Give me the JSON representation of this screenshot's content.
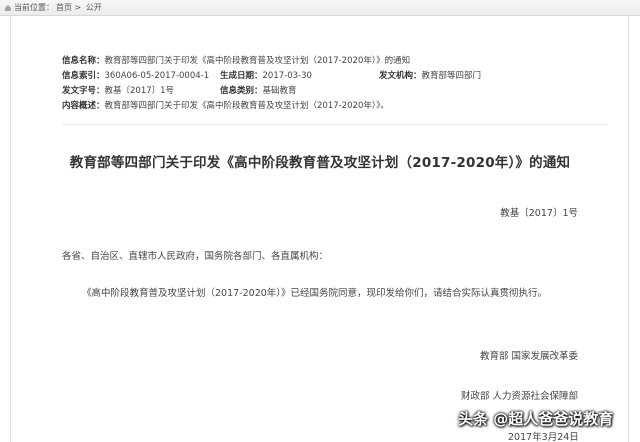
{
  "breadcrumb": {
    "prefix": "当前位置：",
    "home": "首页",
    "separator": ">",
    "current": "公开"
  },
  "meta": {
    "name_label": "信息名称：",
    "name_value": "教育部等四部门关于印发《高中阶段教育普及攻坚计划（2017-2020年）》的通知",
    "index_label": "信息索引：",
    "index_value": "360A06-05-2017-0004-1",
    "date_label": "生成日期：",
    "date_value": "2017-03-30",
    "org_label": "发文机构：",
    "org_value": "教育部等四部门",
    "docno_label": "发文字号：",
    "docno_value": "教基〔2017〕1号",
    "category_label": "信息类别：",
    "category_value": "基础教育",
    "summary_label": "内容概述：",
    "summary_value": "教育部等四部门关于印发《高中阶段教育普及攻坚计划（2017-2020年）》。"
  },
  "document": {
    "title": "教育部等四部门关于印发《高中阶段教育普及攻坚计划（2017-2020年）》的通知",
    "doc_number": "教基〔2017〕1号",
    "salutation": "各省、自治区、直辖市人民政府，国务院各部门、各直属机构：",
    "paragraph": "《高中阶段教育普及攻坚计划（2017-2020年）》已经国务院同意，现印发给你们，请结合实际认真贯彻执行。",
    "signature_line1": "教育部 国家发展改革委",
    "signature_line2": "财政部 人力资源社会保障部",
    "date": "2017年3月24日"
  },
  "watermark": {
    "text": "头条 @超人爸爸说教育"
  }
}
